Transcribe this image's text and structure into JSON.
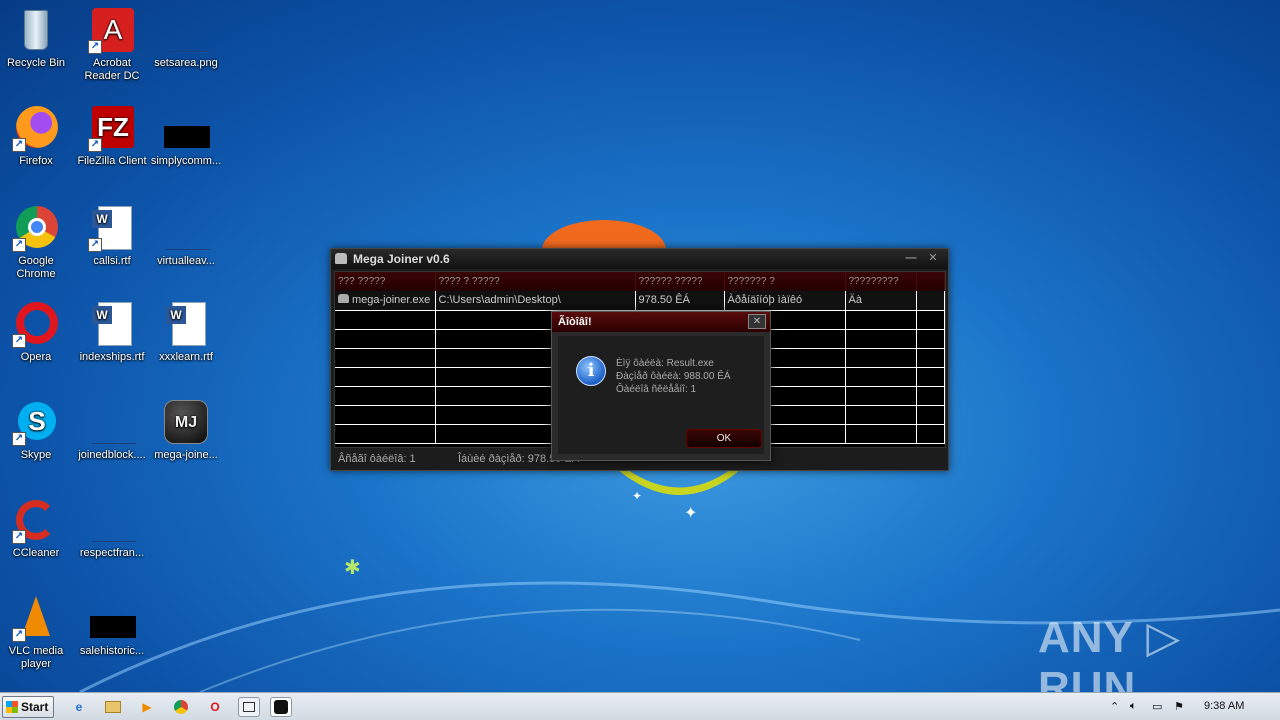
{
  "desktop": {
    "icons": [
      {
        "label": "Recycle Bin",
        "type": "recycle"
      },
      {
        "label": "Acrobat Reader DC",
        "type": "acrobat"
      },
      {
        "label": "setsarea.png",
        "type": "blank"
      },
      {
        "label": "Firefox",
        "type": "firefox"
      },
      {
        "label": "FileZilla Client",
        "type": "filezilla"
      },
      {
        "label": "simplycomm...",
        "type": "black"
      },
      {
        "label": "Google Chrome",
        "type": "chrome"
      },
      {
        "label": "callsi.rtf",
        "type": "word"
      },
      {
        "label": "virtualleav...",
        "type": "blank"
      },
      {
        "label": "Opera",
        "type": "opera"
      },
      {
        "label": "indexships.rtf",
        "type": "word"
      },
      {
        "label": "xxxlearn.rtf",
        "type": "word"
      },
      {
        "label": "Skype",
        "type": "skype"
      },
      {
        "label": "joinedblock....",
        "type": "blank"
      },
      {
        "label": "mega-joine...",
        "type": "mj"
      },
      {
        "label": "CCleaner",
        "type": "ccleaner"
      },
      {
        "label": "respectfran...",
        "type": "blank"
      },
      {
        "label": "VLC media player",
        "type": "vlc"
      },
      {
        "label": "salehistoric...",
        "type": "black"
      }
    ]
  },
  "app_window": {
    "title": "Mega Joiner v0.6",
    "columns": [
      "??? ?????",
      "???? ? ?????",
      "?????? ?????",
      "??????? ?",
      "?????????"
    ],
    "rows": [
      [
        "mega-joiner.exe",
        "C:\\Users\\admin\\Desktop\\",
        "978.50 ÊÁ",
        "Àðåíäîíóþ ìàïêó",
        "Äà"
      ]
    ],
    "status_left": "Âñåãî ôàéëîâ: 1",
    "status_right": "Îáùèé ðàçìåð: 978.50 ÊÁ"
  },
  "dialog": {
    "title": "Ãîòîâî!",
    "lines": [
      "Èìÿ ôàéëà: Result.exe",
      "Ðàçìåð ôàéëà: 988.00 ÊÁ",
      "Ôàéëîâ ñêëååíî: 1"
    ],
    "ok_label": "OK"
  },
  "taskbar": {
    "start_label": "Start",
    "clock": "9:38 AM"
  },
  "watermark": "ANY ▷ RUN",
  "colors": {
    "accent": "#5a0b0b",
    "desktop": "#1b74c9"
  }
}
